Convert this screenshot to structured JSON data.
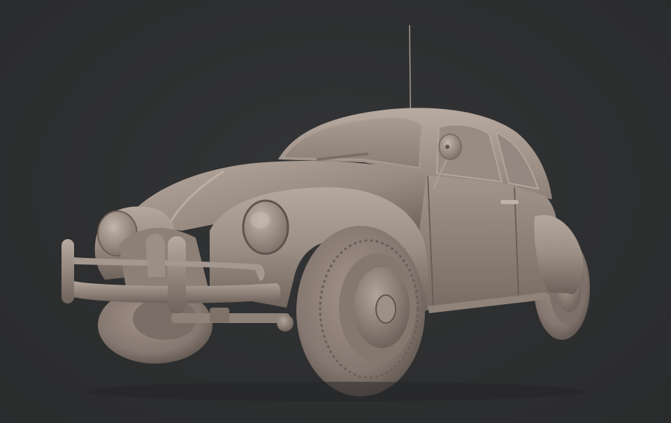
{
  "scene": {
    "subject": "car-render",
    "colors": {
      "background": "#2e2f30",
      "body_base": "#8a7d73",
      "body_light": "#b3a69c",
      "body_dark": "#5c524b",
      "tire": "#8b8078",
      "tire_dark": "#574e48",
      "shadow": "#1f1f20"
    }
  }
}
